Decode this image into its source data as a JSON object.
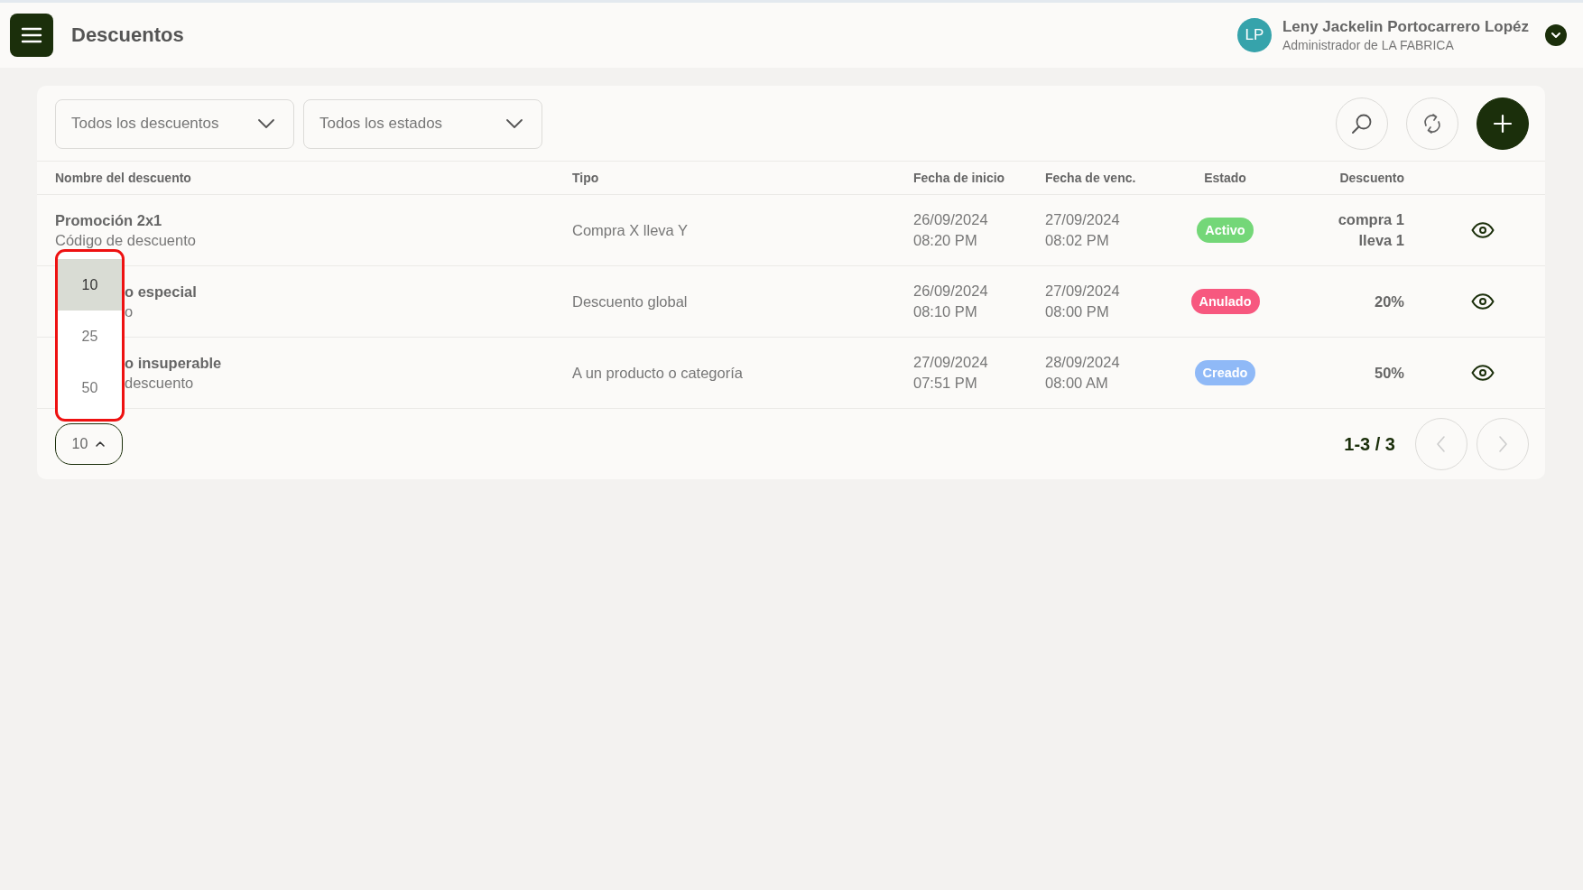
{
  "header": {
    "title": "Descuentos",
    "user": {
      "initials": "LP",
      "name": "Leny Jackelin Portocarrero Lopéz",
      "role": "Administrador de LA FABRICA"
    }
  },
  "filters": [
    {
      "value": "Todos los descuentos"
    },
    {
      "value": "Todos los estados"
    }
  ],
  "table": {
    "columns": [
      "Nombre del descuento",
      "Tipo",
      "Fecha de inicio",
      "Fecha de venc.",
      "Estado",
      "Descuento"
    ],
    "rows": [
      {
        "name": "Promoción 2x1",
        "code": "Código de descuento",
        "hidden_by_menu": false,
        "type": "Compra X lleva Y",
        "start_date": "26/09/2024",
        "start_time": "08:20 PM",
        "end_date": "27/09/2024",
        "end_time": "08:02 PM",
        "status": "Activo",
        "color": "#74d778",
        "discount": [
          "compra 1",
          "lleva 1"
        ]
      },
      {
        "name": "o especial",
        "code": "o",
        "hidden_by_menu": true,
        "type": "Descuento global",
        "start_date": "26/09/2024",
        "start_time": "08:10 PM",
        "end_date": "27/09/2024",
        "end_time": "08:00 PM",
        "status": "Anulado",
        "color": "#f7587f",
        "discount": [
          "20%"
        ]
      },
      {
        "name": "o insuperable",
        "code": "descuento",
        "hidden_by_menu": true,
        "type": "A un producto o categoría",
        "start_date": "27/09/2024",
        "start_time": "07:51 PM",
        "end_date": "28/09/2024",
        "end_time": "08:00 AM",
        "status": "Creado",
        "color": "#8fb9f7",
        "discount": [
          "50%"
        ]
      }
    ]
  },
  "pagination": {
    "page_size": "10",
    "menu_open": true,
    "options": [
      {
        "label": "10",
        "selected": true
      },
      {
        "label": "25",
        "selected": false
      },
      {
        "label": "50",
        "selected": false
      }
    ],
    "range": "1-3 / 3"
  }
}
